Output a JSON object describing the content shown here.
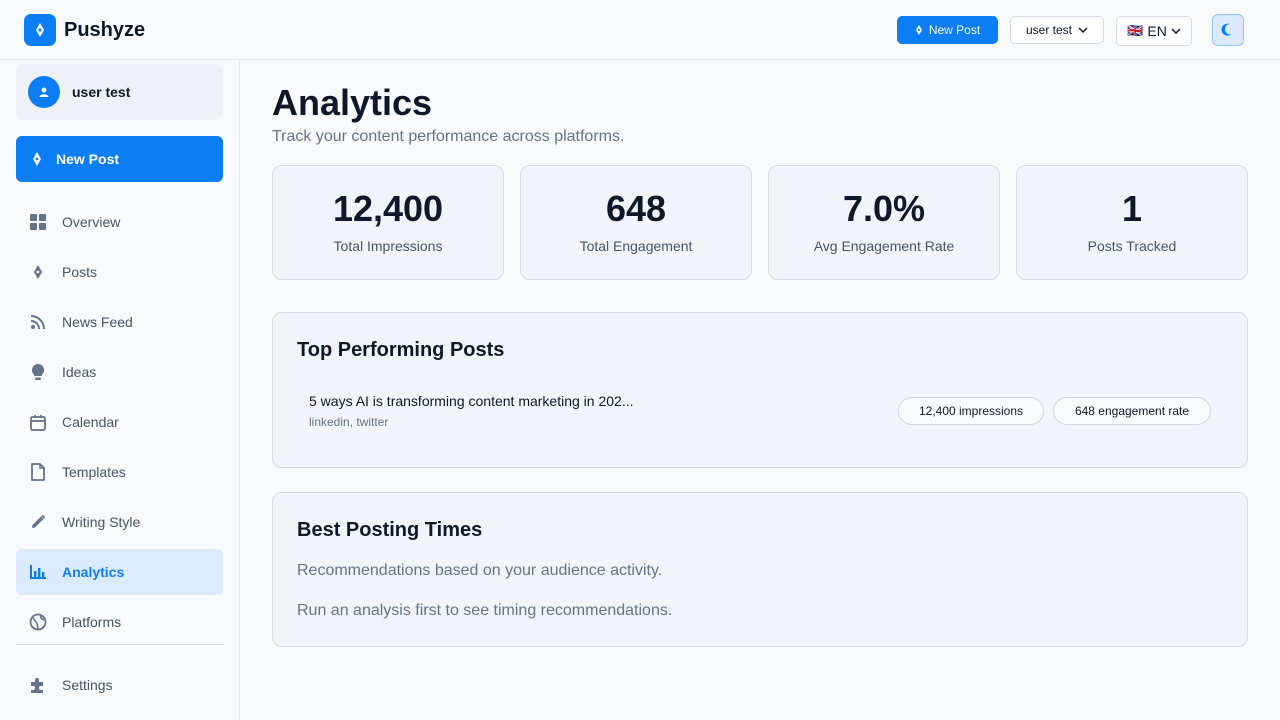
{
  "app": {
    "name": "Pushyze"
  },
  "header": {
    "new_post_label": "New Post",
    "user_menu_label": "user test",
    "language": {
      "flag": "🇬🇧",
      "code": "EN"
    },
    "theme_toggle_icon": "moon-icon"
  },
  "sidebar": {
    "user_name": "user test",
    "new_post_label": "New Post",
    "items": [
      {
        "label": "Overview",
        "icon": "grid-icon"
      },
      {
        "label": "Posts",
        "icon": "pen-nib-icon"
      },
      {
        "label": "News Feed",
        "icon": "rss-icon"
      },
      {
        "label": "Ideas",
        "icon": "lightbulb-icon"
      },
      {
        "label": "Calendar",
        "icon": "calendar-icon"
      },
      {
        "label": "Templates",
        "icon": "document-icon"
      },
      {
        "label": "Writing Style",
        "icon": "pencil-icon"
      },
      {
        "label": "Analytics",
        "icon": "bar-chart-icon",
        "active": true
      },
      {
        "label": "Platforms",
        "icon": "globe-icon"
      }
    ],
    "settings_label": "Settings"
  },
  "main": {
    "title": "Analytics",
    "subtitle": "Track your content performance across platforms.",
    "stats": [
      {
        "value": "12,400",
        "label": "Total Impressions"
      },
      {
        "value": "648",
        "label": "Total Engagement"
      },
      {
        "value": "7.0%",
        "label": "Avg Engagement Rate"
      },
      {
        "value": "1",
        "label": "Posts Tracked"
      }
    ],
    "top_posts": {
      "title": "Top Performing Posts",
      "posts": [
        {
          "title": "5 ways AI is transforming content marketing in 202...",
          "platforms": "linkedin, twitter",
          "impressions": "12,400 impressions",
          "engagement": "648 engagement rate"
        }
      ]
    },
    "best_times": {
      "title": "Best Posting Times",
      "description": "Recommendations based on your audience activity.",
      "empty_message": "Run an analysis first to see timing recommendations."
    }
  },
  "colors": {
    "accent": "#0b7ef5",
    "active_bg": "#dbeafe",
    "text": "#0f172a",
    "muted": "#64748b"
  }
}
